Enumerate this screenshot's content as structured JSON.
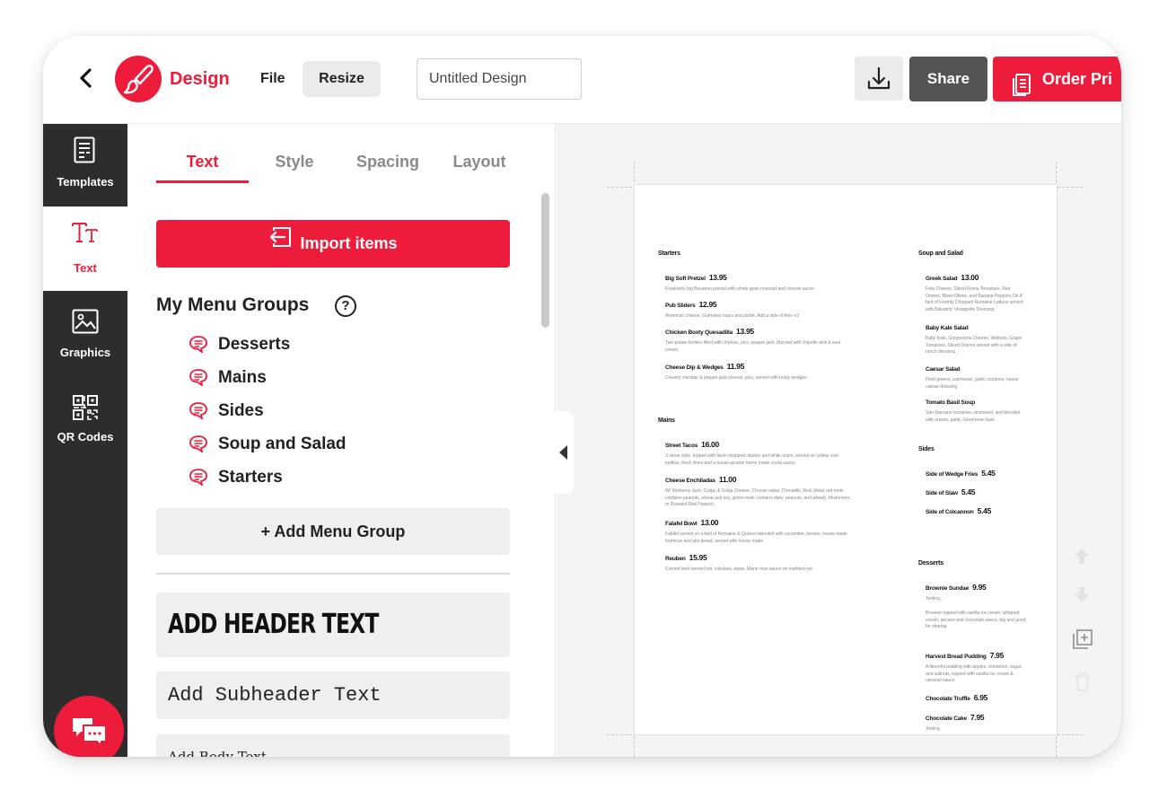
{
  "colors": {
    "brand": "#ee1c3b",
    "rail": "#2d2d2d",
    "share": "#545454"
  },
  "topbar": {
    "back_icon": "chevron-left-icon",
    "logo_icon": "paintbrush-icon",
    "brand": "Design",
    "file": "File",
    "resize": "Resize",
    "title_value": "Untitled Design",
    "download_icon": "download-icon",
    "share": "Share",
    "order": "Order Pri",
    "order_icon": "document-icon"
  },
  "rail": {
    "templates": "Templates",
    "text": "Text",
    "graphics": "Graphics",
    "qr": "QR Codes",
    "chat_icon": "chat-bubbles-icon"
  },
  "panel": {
    "tabs": [
      "Text",
      "Style",
      "Spacing",
      "Layout"
    ],
    "import": "Import items",
    "groups_title": "My Menu Groups",
    "help": "?",
    "groups": [
      "Desserts",
      "Mains",
      "Sides",
      "Soup and Salad",
      "Starters"
    ],
    "add_group": "+ Add Menu Group",
    "header_text": "ADD HEADER TEXT",
    "subheader_text": "Add Subheader Text",
    "body_text": "Add Body Text"
  },
  "menu": {
    "left": [
      {
        "section": "Starters",
        "items": [
          {
            "name": "Big Soft Pretzel",
            "price": "13.95",
            "desc": "Freakishly big Bavarian pretzel with whole grain mustard and cheese sauce"
          },
          {
            "name": "Pub Sliders",
            "price": "12.95",
            "desc": "American cheese, Guinness mayo and pickle. Add a side of fries +3"
          },
          {
            "name": "Chicken Boxty Quesadilla",
            "price": "13.95",
            "desc": "Two potato boxties filled with chicken, pico, pepper jack, drizzled with chipotle aioli & sour cream"
          },
          {
            "name": "Cheese Dip & Wedges",
            "price": "11.95",
            "desc": "Creamy cheddar & pepper jack cheese, pico, served with boxty wedges"
          }
        ]
      },
      {
        "section": "Mains",
        "items": [
          {
            "name": "Street Tacos",
            "price": "16.00",
            "desc": "3 street style, topped with fresh chopped cilantro and white onion, served on yellow corn tortillas, fresh limes and a house picante home made cruda sauce."
          },
          {
            "name": "Cheese Enchiladas",
            "price": "11.00",
            "desc": "W/ Monterey Jack, Cotija, & Cotija Cheese. Choose salsa: (Tomatillo, Red, Mole( red mole contains peanuts, wheat and soy, green mole contains dairy, peanuts, and wheat), Mushroom, or Roasted Red Pepper)."
          },
          {
            "name": "Falafel Bowl",
            "price": "13.00",
            "desc": "Falafel served on a bed of Romaine & Quinoa tabouleh with cucumber, tomato, house made hummus and pita bread, served with house made"
          },
          {
            "name": "Reuben",
            "price": "15.95",
            "desc": "Corned beef served hot, coleslaw, swiss, Marie rose sauce on marbled rye"
          }
        ]
      }
    ],
    "right": [
      {
        "section": "Soup and Salad",
        "items": [
          {
            "name": "Greek Salad",
            "price": "13.00",
            "desc": "Feta Cheese, Sliced Roma Tomatoes, Red Onions, Black Olives, and Banana Peppers On A bed of Freshly Chopped Romaine Lettuce served with Balsamic Vinaigrette Dressing."
          },
          {
            "name": "Baby Kale Salad",
            "price": "",
            "desc": "Baby Kale, Gorgonzola Cheese, Walnuts, Grape Tomatoes, Sliced Onions served with a side of ranch dressing."
          },
          {
            "name": "Caesar Salad",
            "price": "",
            "desc": "Field greens, parmesan, garlic croutons, house caesar dressing"
          },
          {
            "name": "Tomato Basil Soup",
            "price": "",
            "desc": "San Marzano tomatoes simmered, and blended with onions, garlic, Genovese basil."
          }
        ]
      },
      {
        "section": "Sides",
        "items": [
          {
            "name": "Side of Wedge Fries",
            "price": "5.45",
            "desc": ""
          },
          {
            "name": "Side of Slaw",
            "price": "5.45",
            "desc": ""
          },
          {
            "name": "Side of Colcannon",
            "price": "5.45",
            "desc": ""
          }
        ]
      },
      {
        "section": "Desserts",
        "items": [
          {
            "name": "Brownie Sundae",
            "price": "9.95",
            "desc": "Testing..."
          },
          {
            "name": "",
            "price": "",
            "desc": "Brownie topped with vanilla ice cream, whipped cream, pecans and chocolate sauce, big and good for sharing"
          },
          {
            "name": "Harvest Bread Pudding",
            "price": "7.95",
            "desc": "A flavorful pudding with apples, cinnamon, sugar, and walnuts, topped with vanilla ice cream & caramel sauce"
          },
          {
            "name": "Chocolate Truffle",
            "price": "6.95",
            "desc": ""
          },
          {
            "name": "Chocolate Cake",
            "price": "7.95",
            "desc": "Testing"
          }
        ]
      }
    ]
  },
  "tools": [
    "arrow-up-icon",
    "arrow-down-icon",
    "duplicate-icon",
    "trash-icon"
  ]
}
